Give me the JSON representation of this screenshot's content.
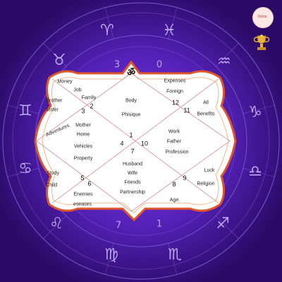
{
  "chart_center_symbol": "ॐ",
  "logo": {
    "text": "Onlne"
  },
  "ring_numbers": [
    "3",
    "0",
    "1",
    "7"
  ],
  "houses": [
    {
      "number": "1",
      "topics": [
        "Body",
        "Phisique"
      ]
    },
    {
      "number": "2",
      "topics": [
        "Money",
        "Job",
        "Family"
      ]
    },
    {
      "number": "3",
      "topics": [
        "Brother",
        "Sister",
        "Adventures"
      ]
    },
    {
      "number": "4",
      "topics": [
        "Mother",
        "Home",
        "Vehicles",
        "Property"
      ]
    },
    {
      "number": "5",
      "topics": [
        "Study",
        "Child"
      ]
    },
    {
      "number": "6",
      "topics": [
        "Enemies",
        "eseases"
      ]
    },
    {
      "number": "7",
      "topics": [
        "Husband",
        "Wife",
        "Friends",
        "Partnership"
      ]
    },
    {
      "number": "8",
      "topics": [
        "Age"
      ]
    },
    {
      "number": "9",
      "topics": [
        "Luck",
        "Religion"
      ]
    },
    {
      "number": "10",
      "topics": [
        "Work",
        "Father",
        "Profession"
      ]
    },
    {
      "number": "11",
      "topics": [
        "All",
        "Benefits"
      ]
    },
    {
      "number": "12",
      "topics": [
        "Expenses",
        "Foreign"
      ]
    }
  ],
  "zodiac_signs": [
    {
      "name": "aries-icon",
      "glyph": "♈"
    },
    {
      "name": "taurus-icon",
      "glyph": "♉"
    },
    {
      "name": "gemini-icon",
      "glyph": "♊"
    },
    {
      "name": "cancer-icon",
      "glyph": "♋"
    },
    {
      "name": "leo-icon",
      "glyph": "♌"
    },
    {
      "name": "virgo-icon",
      "glyph": "♍"
    },
    {
      "name": "libra-icon",
      "glyph": "♎"
    },
    {
      "name": "scorpio-icon",
      "glyph": "♏"
    },
    {
      "name": "sagittarius-icon",
      "glyph": "♐"
    },
    {
      "name": "capricorn-icon",
      "glyph": "♑"
    },
    {
      "name": "aquarius-icon",
      "glyph": "♒"
    },
    {
      "name": "pisces-icon",
      "glyph": "♓"
    }
  ],
  "colors": {
    "background": "#3b0f86",
    "wheel_glow": "#6a2fd0",
    "chart_fill": "#ffffff",
    "chart_border": "#e0542a",
    "chart_lines": "#d9a0a0"
  }
}
